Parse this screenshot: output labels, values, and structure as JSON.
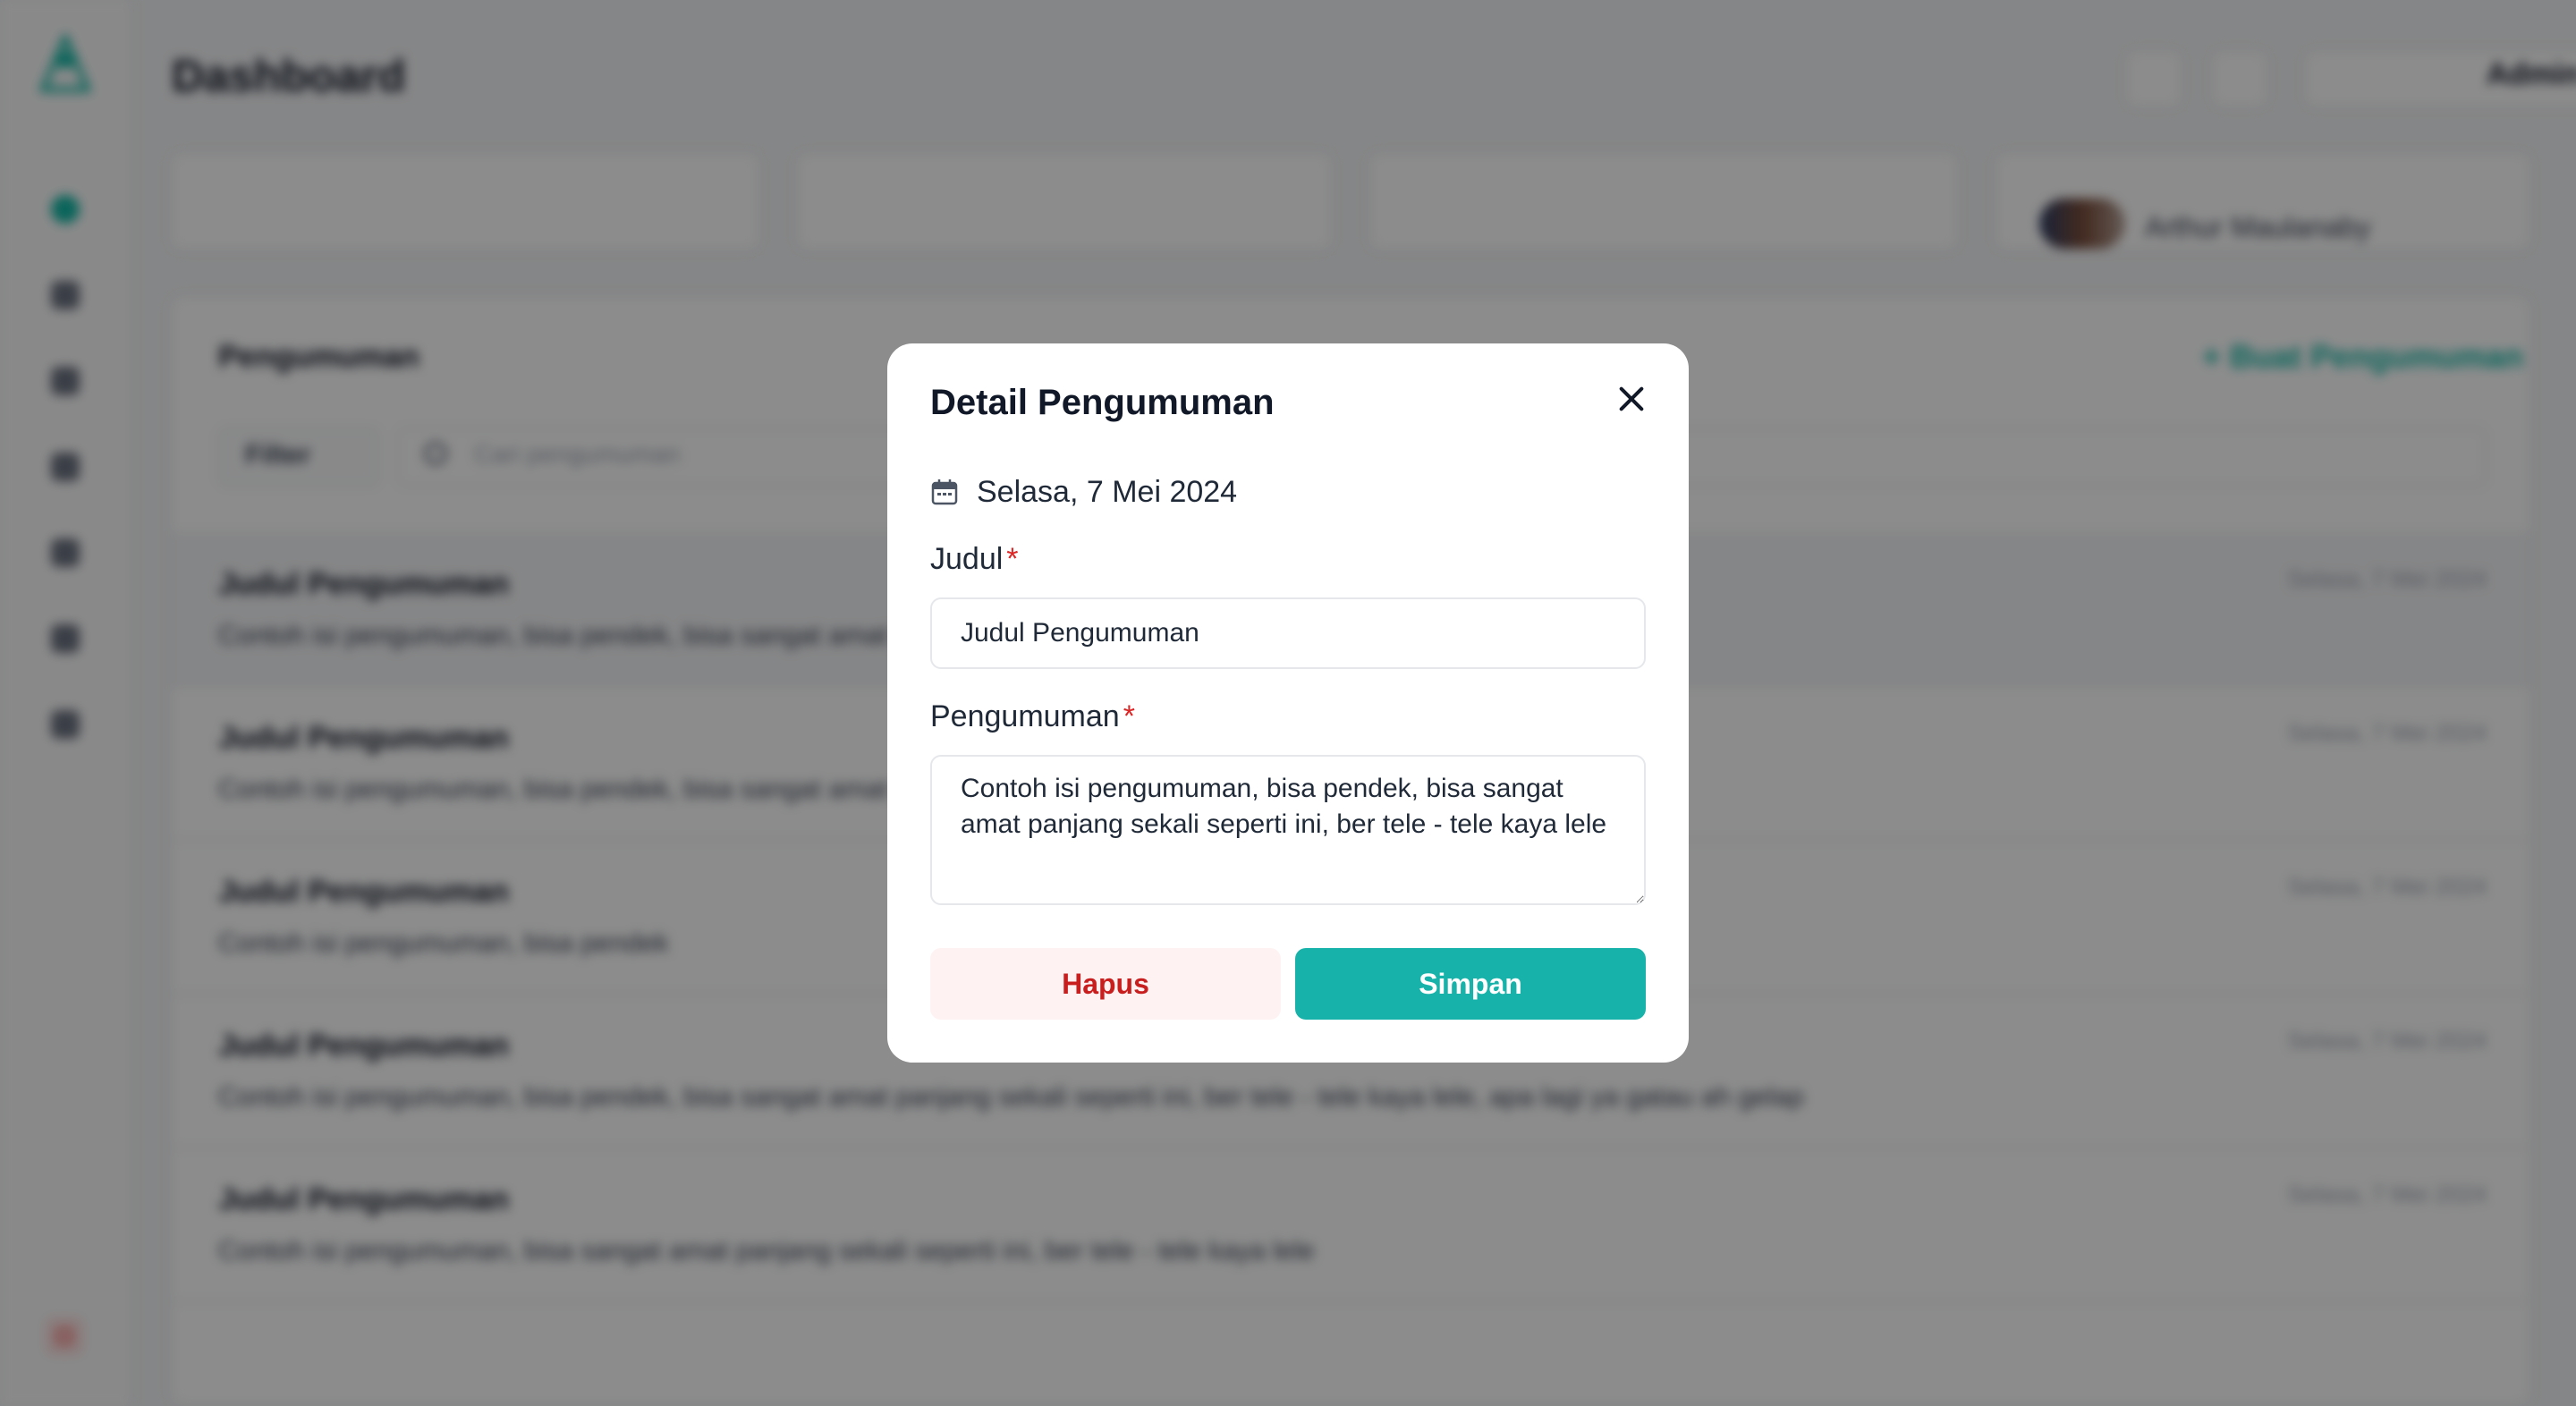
{
  "app": {
    "page_title": "Dashboard",
    "admin_name": "Admin",
    "stat_user_name": "Arthur Maulanaby",
    "panel_title": "Pengumuman",
    "add_button": "+ Buat Pengumuman",
    "filter_label": "Filter",
    "search_placeholder": "Cari pengumuman",
    "announcements": [
      {
        "title": "Judul Pengumuman",
        "body": "Contoh isi pengumuman, bisa pendek, bisa sangat amat panjang sekali seperti ini, ber tele - tele kaya lele",
        "date": "Selasa, 7 Mei 2024"
      },
      {
        "title": "Judul Pengumuman",
        "body": "Contoh isi pengumuman, bisa pendek, bisa sangat amat panjang sekali seperti ini, ber tele - tele kaya lele",
        "date": "Selasa, 7 Mei 2024"
      },
      {
        "title": "Judul Pengumuman",
        "body": "Contoh isi pengumuman, bisa pendek",
        "date": "Selasa, 7 Mei 2024"
      },
      {
        "title": "Judul Pengumuman",
        "body": "Contoh isi pengumuman, bisa pendek, bisa sangat amat panjang sekali seperti ini, ber tele - tele kaya lele, apa lagi ya gatau ah gelap",
        "date": "Selasa, 7 Mei 2024"
      },
      {
        "title": "Judul Pengumuman",
        "body": "Contoh isi pengumuman, bisa sangat amat panjang sekali seperti ini, ber tele - tele kaya lele",
        "date": "Selasa, 7 Mei 2024"
      }
    ]
  },
  "modal": {
    "title": "Detail Pengumuman",
    "close_icon": "close-icon",
    "date_icon": "calendar-icon",
    "date": "Selasa, 7 Mei 2024",
    "judul_label": "Judul",
    "required_mark": "*",
    "judul_value": "Judul Pengumuman",
    "pengumuman_label": "Pengumuman",
    "pengumuman_value": "Contoh isi pengumuman, bisa pendek, bisa sangat amat panjang sekali seperti ini, ber tele - tele kaya lele",
    "delete_label": "Hapus",
    "save_label": "Simpan"
  },
  "colors": {
    "accent": "#17b3aa",
    "danger_text": "#c81e1e",
    "danger_bg": "#fef2f2",
    "required": "#dc2626"
  }
}
